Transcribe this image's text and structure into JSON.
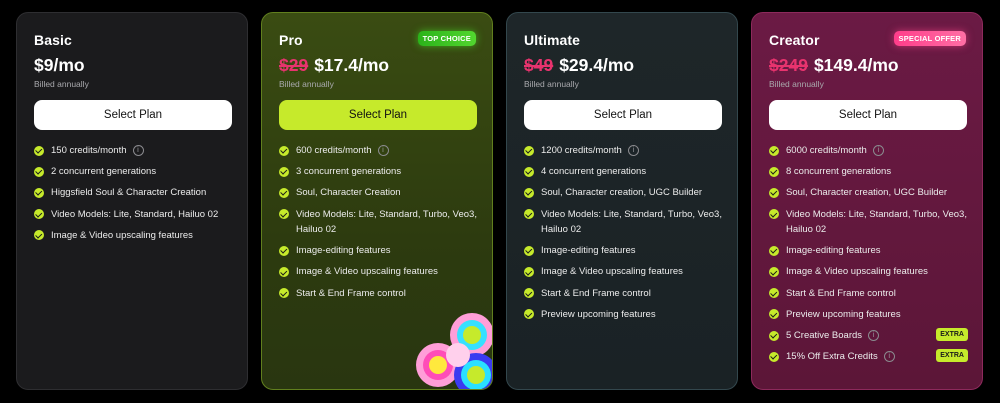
{
  "plans": [
    {
      "name": "Basic",
      "badge": "",
      "old_price": "",
      "price": "$9/mo",
      "billing": "Billed annually",
      "button": "Select Plan",
      "features": [
        {
          "text": "150 credits/month"
        },
        {
          "text": "2 concurrent generations"
        },
        {
          "text": "Higgsfield Soul & Character Creation"
        },
        {
          "text": "Video Models: Lite, Standard, Hailuo 02"
        },
        {
          "text": "Image & Video upscaling features"
        }
      ]
    },
    {
      "name": "Pro",
      "badge": "TOP CHOICE",
      "old_price": "$29",
      "price": "$17.4/mo",
      "billing": "Billed annually",
      "button": "Select Plan",
      "features": [
        {
          "text": "600 credits/month"
        },
        {
          "text": "3 concurrent generations"
        },
        {
          "text": "Soul, Character Creation"
        },
        {
          "text": "Video Models: Lite, Standard, Turbo, Veo3, Hailuo 02"
        },
        {
          "text": "Image-editing features"
        },
        {
          "text": "Image & Video upscaling features"
        },
        {
          "text": "Start & End Frame control"
        }
      ]
    },
    {
      "name": "Ultimate",
      "badge": "",
      "old_price": "$49",
      "price": "$29.4/mo",
      "billing": "Billed annually",
      "button": "Select Plan",
      "features": [
        {
          "text": "1200 credits/month"
        },
        {
          "text": "4 concurrent generations"
        },
        {
          "text": "Soul, Character creation, UGC Builder"
        },
        {
          "text": "Video Models: Lite, Standard, Turbo, Veo3, Hailuo 02"
        },
        {
          "text": "Image-editing features"
        },
        {
          "text": "Image & Video upscaling features"
        },
        {
          "text": "Start & End Frame control"
        },
        {
          "text": "Preview upcoming features"
        }
      ]
    },
    {
      "name": "Creator",
      "badge": "SPECIAL OFFER",
      "old_price": "$249",
      "price": "$149.4/mo",
      "billing": "Billed annually",
      "button": "Select Plan",
      "features": [
        {
          "text": "6000 credits/month"
        },
        {
          "text": "8 concurrent generations"
        },
        {
          "text": "Soul, Character creation, UGC Builder"
        },
        {
          "text": "Video Models: Lite, Standard, Turbo, Veo3, Hailuo 02"
        },
        {
          "text": "Image-editing features"
        },
        {
          "text": "Image & Video upscaling features"
        },
        {
          "text": "Start & End Frame control"
        },
        {
          "text": "Preview upcoming features"
        },
        {
          "text": "5 Creative Boards",
          "tag": "EXTRA"
        },
        {
          "text": "15% Off Extra Credits",
          "tag": "EXTRA"
        }
      ]
    }
  ],
  "info_icon_glyph": "i",
  "colors": {
    "accent_lime": "#c6ea2b",
    "old_price_red": "#e8336e",
    "badge_green": "#3cc524",
    "badge_pink": "#ff4d93"
  }
}
